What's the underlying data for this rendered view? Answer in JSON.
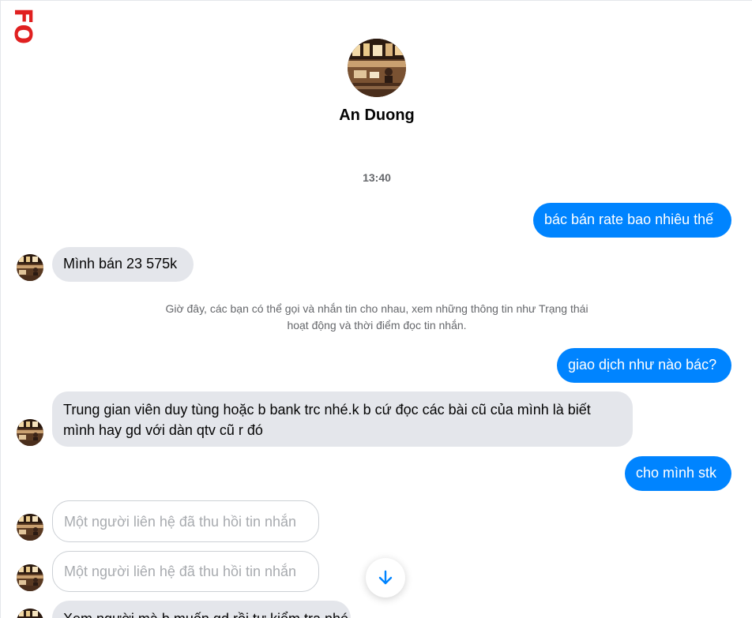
{
  "watermark": {
    "text": "FO"
  },
  "header": {
    "name": "An Duong",
    "avatar_icon": "profile-photo-restaurant"
  },
  "timestamp": "13:40",
  "messages": [
    {
      "direction": "out",
      "text": "bác bán rate bao nhiêu thế"
    },
    {
      "direction": "in",
      "text": "Mình bán 23 575k"
    },
    {
      "direction": "notice",
      "line1": "Giờ đây, các bạn có thể gọi và nhắn tin cho nhau, xem những thông tin như Trạng thái",
      "line2": "hoạt động và thời điểm đọc tin nhắn."
    },
    {
      "direction": "out",
      "text": "giao dịch như nào bác?"
    },
    {
      "direction": "in",
      "line1": "Trung gian viên duy tùng hoặc b bank trc nhé.k b cứ đọc các bài cũ của mình là biết",
      "line2": "mình hay gd với dàn qtv cũ r đó"
    },
    {
      "direction": "out",
      "text": "cho mình stk"
    },
    {
      "direction": "in-unsent",
      "text": "Một người liên hệ đã thu hồi tin nhắn"
    },
    {
      "direction": "in-unsent",
      "text": "Một người liên hệ đã thu hồi tin nhắn"
    },
    {
      "direction": "in",
      "text": "Xem người mà b muốn gd rồi tự kiểm tra nhé"
    }
  ],
  "scroll_button": {
    "icon": "arrow-down-icon"
  },
  "colors": {
    "outgoing_bubble": "#0084ff",
    "incoming_bubble": "#e4e6eb",
    "watermark": "#e02020",
    "secondary_text": "#65676b"
  }
}
